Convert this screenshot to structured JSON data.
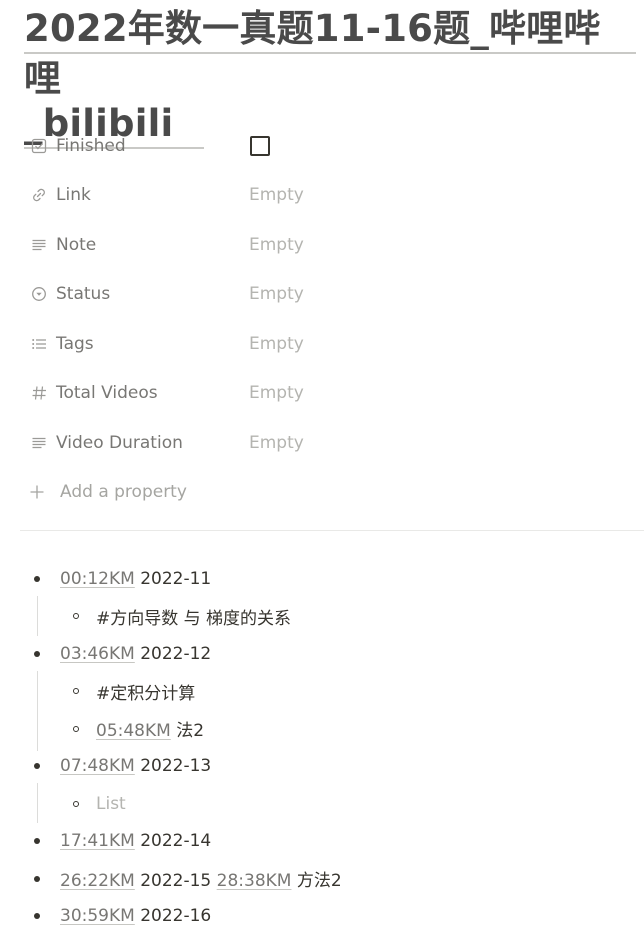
{
  "title": {
    "line1": "2022年数一真题11-16题_哔哩哔",
    "line2": "哩_bilibili"
  },
  "properties": [
    {
      "icon": "checkbox-icon",
      "name": "Finished",
      "type": "checkbox",
      "checked": false
    },
    {
      "icon": "link-icon",
      "name": "Link",
      "value": "Empty"
    },
    {
      "icon": "text-lines-icon",
      "name": "Note",
      "value": "Empty"
    },
    {
      "icon": "status-circle-icon",
      "name": "Status",
      "value": "Empty"
    },
    {
      "icon": "list-icon",
      "name": "Tags",
      "value": "Empty"
    },
    {
      "icon": "hash-icon",
      "name": "Total Videos",
      "value": "Empty"
    },
    {
      "icon": "text-lines-icon",
      "name": "Video Duration",
      "value": "Empty"
    }
  ],
  "add_property": {
    "icon": "plus-icon",
    "label": "Add a property"
  },
  "bullets": [
    {
      "ts": "00:12KM",
      "text": " 2022-11",
      "children": [
        {
          "text": "#方向导数 与 梯度的关系"
        }
      ]
    },
    {
      "ts": "03:46KM",
      "text": " 2022-12",
      "children": [
        {
          "text": "#定积分计算"
        },
        {
          "ts": "05:48KM",
          "text": " 法2"
        }
      ]
    },
    {
      "ts": "07:48KM",
      "text": " 2022-13",
      "children": [
        {
          "placeholder": "List"
        }
      ]
    },
    {
      "ts": "17:41KM",
      "text": " 2022-14"
    },
    {
      "ts": "26:22KM",
      "text": " 2022-15 ",
      "ts2": "28:38KM",
      "text2": " 方法2"
    },
    {
      "ts": "30:59KM",
      "text": " 2022-16"
    }
  ]
}
